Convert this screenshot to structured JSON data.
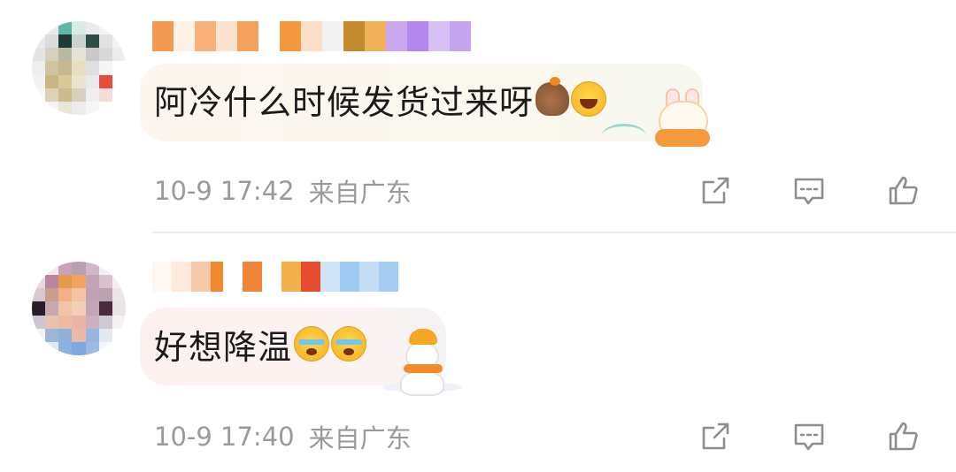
{
  "comments": [
    {
      "text": "阿冷什么时候发货过来呀",
      "emojis": [
        "capybara-emoji",
        "laughing-emoji"
      ],
      "sticker": "rabbit-mooncake-sticker",
      "time": "10-9 17:42",
      "location": "来自广东"
    },
    {
      "text": "好想降温",
      "emojis": [
        "crying-emoji",
        "crying-emoji"
      ],
      "sticker": "snowman-sticker",
      "time": "10-9 17:40",
      "location": "来自广东"
    }
  ],
  "actions": [
    "share-icon",
    "comment-icon",
    "like-icon"
  ],
  "colors": {
    "text": "#1b1b1b",
    "meta": "#9a9a9a",
    "icon": "#8e8e8e",
    "divider": "#ececec"
  }
}
